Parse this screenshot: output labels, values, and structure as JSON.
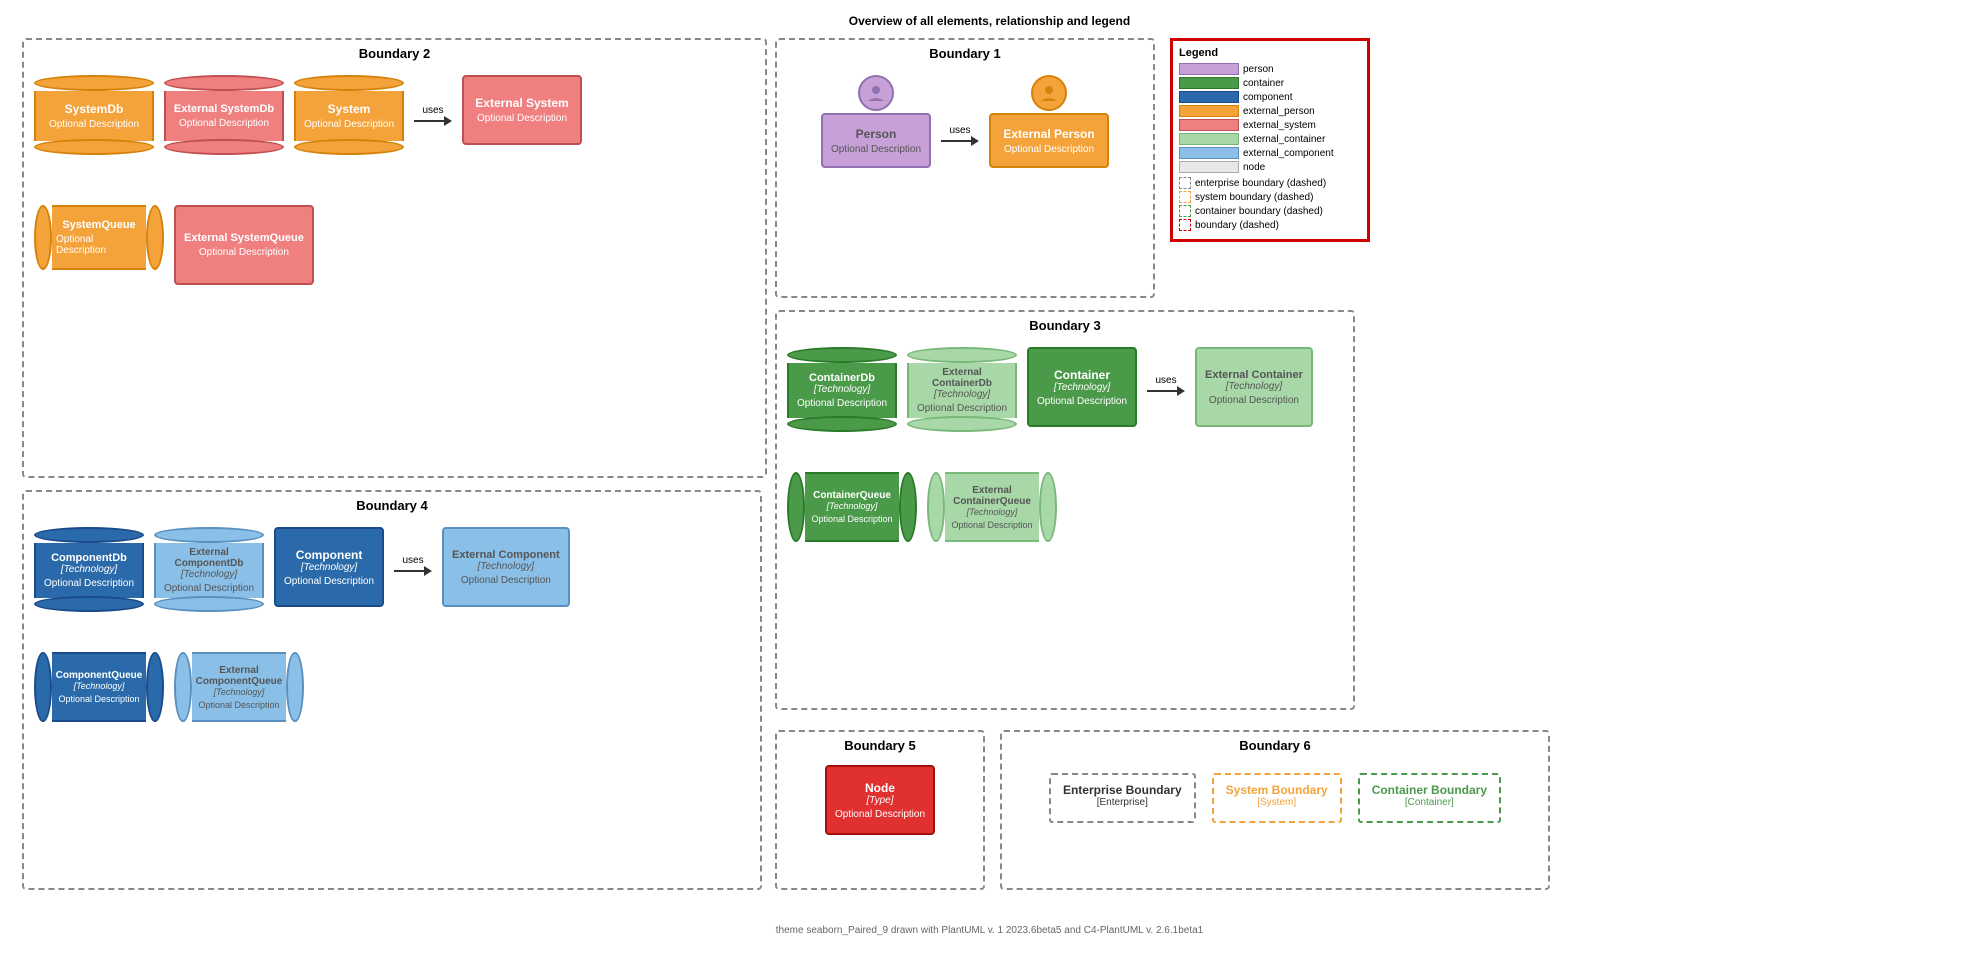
{
  "title": "Overview of all elements, relationship and legend",
  "footer": "theme seaborn_Paired_9 drawn with PlantUML v. 1 2023.6beta5 and C4-PlantUML v. 2.6.1beta1",
  "boundary2": {
    "label": "Boundary 2",
    "row1": [
      {
        "id": "systemDb",
        "name": "SystemDb",
        "desc": "Optional Description",
        "type": "db",
        "color": "system"
      },
      {
        "id": "extSystemDb",
        "name": "External SystemDb",
        "desc": "Optional Description",
        "type": "db",
        "color": "ext-system"
      },
      {
        "id": "system",
        "name": "System",
        "desc": "Optional Description",
        "type": "db",
        "color": "system"
      },
      {
        "id": "extSystem",
        "name": "External System",
        "desc": "Optional Description",
        "type": "box",
        "color": "ext-system",
        "uses": true
      }
    ],
    "row2": [
      {
        "id": "systemQueue",
        "name": "SystemQueue",
        "desc": "Optional Description",
        "type": "queue",
        "color": "system"
      },
      {
        "id": "extSystemQueue",
        "name": "External SystemQueue",
        "desc": "Optional Description",
        "type": "box-tall",
        "color": "ext-system"
      }
    ]
  },
  "boundary1": {
    "label": "Boundary 1",
    "row1": [
      {
        "id": "person",
        "name": "Person",
        "desc": "Optional Description",
        "type": "person",
        "color": "person"
      },
      {
        "id": "extPerson",
        "name": "External Person",
        "desc": "Optional Description",
        "type": "person",
        "color": "ext-person",
        "uses": true
      }
    ]
  },
  "boundary3": {
    "label": "Boundary 3",
    "row1": [
      {
        "id": "containerDb",
        "name": "ContainerDb",
        "tech": "[Technology]",
        "desc": "Optional Description",
        "type": "db",
        "color": "container"
      },
      {
        "id": "extContainerDb",
        "name": "External ContainerDb",
        "tech": "[Technology]",
        "desc": "Optional Description",
        "type": "db",
        "color": "ext-container"
      },
      {
        "id": "container",
        "name": "Container",
        "tech": "[Technology]",
        "desc": "Optional Description",
        "type": "box",
        "color": "container",
        "uses": true
      },
      {
        "id": "extContainer",
        "name": "External Container",
        "tech": "[Technology]",
        "desc": "Optional Description",
        "type": "box",
        "color": "ext-container"
      }
    ],
    "row2": [
      {
        "id": "containerQueue",
        "name": "ContainerQueue",
        "tech": "[Technology]",
        "desc": "Optional Description",
        "type": "queue",
        "color": "container"
      },
      {
        "id": "extContainerQueue",
        "name": "External ContainerQueue",
        "tech": "[Technology]",
        "desc": "Optional Description",
        "type": "queue",
        "color": "ext-container"
      }
    ]
  },
  "boundary4": {
    "label": "Boundary 4",
    "row1": [
      {
        "id": "componentDb",
        "name": "ComponentDb",
        "tech": "[Technology]",
        "desc": "Optional Description",
        "type": "db",
        "color": "component"
      },
      {
        "id": "extComponentDb",
        "name": "External ComponentDb",
        "tech": "[Technology]",
        "desc": "Optional Description",
        "type": "db",
        "color": "ext-component"
      },
      {
        "id": "component",
        "name": "Component",
        "tech": "[Technology]",
        "desc": "Optional Description",
        "type": "box",
        "color": "component",
        "uses": true
      },
      {
        "id": "extComponent",
        "name": "External Component",
        "tech": "[Technology]",
        "desc": "Optional Description",
        "type": "box",
        "color": "ext-component"
      }
    ],
    "row2": [
      {
        "id": "componentQueue",
        "name": "ComponentQueue",
        "tech": "[Technology]",
        "desc": "Optional Description",
        "type": "queue",
        "color": "component"
      },
      {
        "id": "extComponentQueue",
        "name": "External ComponentQueue",
        "tech": "[Technology]",
        "desc": "Optional Description",
        "type": "queue",
        "color": "ext-component"
      }
    ]
  },
  "boundary5": {
    "label": "Boundary 5",
    "node": {
      "name": "Node",
      "tech": "[Type]",
      "desc": "Optional Description",
      "color": "node"
    }
  },
  "boundary6": {
    "label": "Boundary 6",
    "items": [
      {
        "name": "Enterprise Boundary",
        "sub": "[Enterprise]",
        "borderColor": "#888",
        "textColor": "#333"
      },
      {
        "name": "System Boundary",
        "sub": "[System]",
        "borderColor": "#f4a23a",
        "textColor": "#f4a23a"
      },
      {
        "name": "Container Boundary",
        "sub": "[Container]",
        "borderColor": "#4a9a4a",
        "textColor": "#4a9a4a"
      }
    ]
  },
  "legend": {
    "title": "Legend",
    "swatches": [
      {
        "label": "person",
        "color": "#c8a0d8"
      },
      {
        "label": "container",
        "color": "#4a9a4a"
      },
      {
        "label": "component",
        "color": "#2a6aaa"
      },
      {
        "label": "external_person",
        "color": "#f4a23a"
      },
      {
        "label": "external_system",
        "color": "#f08080"
      },
      {
        "label": "external_container",
        "color": "#a8d8a8"
      },
      {
        "label": "external_component",
        "color": "#8ac0e8"
      },
      {
        "label": "node",
        "color": "#e8e8e8"
      }
    ],
    "dashed": [
      {
        "label": "enterprise boundary (dashed)",
        "color": "#888"
      },
      {
        "label": "system boundary (dashed)",
        "color": "#f4a23a"
      },
      {
        "label": "container boundary (dashed)",
        "color": "#4a9a4a"
      },
      {
        "label": "boundary (dashed)",
        "color": "#cc0000"
      }
    ]
  },
  "uses_label": "uses"
}
